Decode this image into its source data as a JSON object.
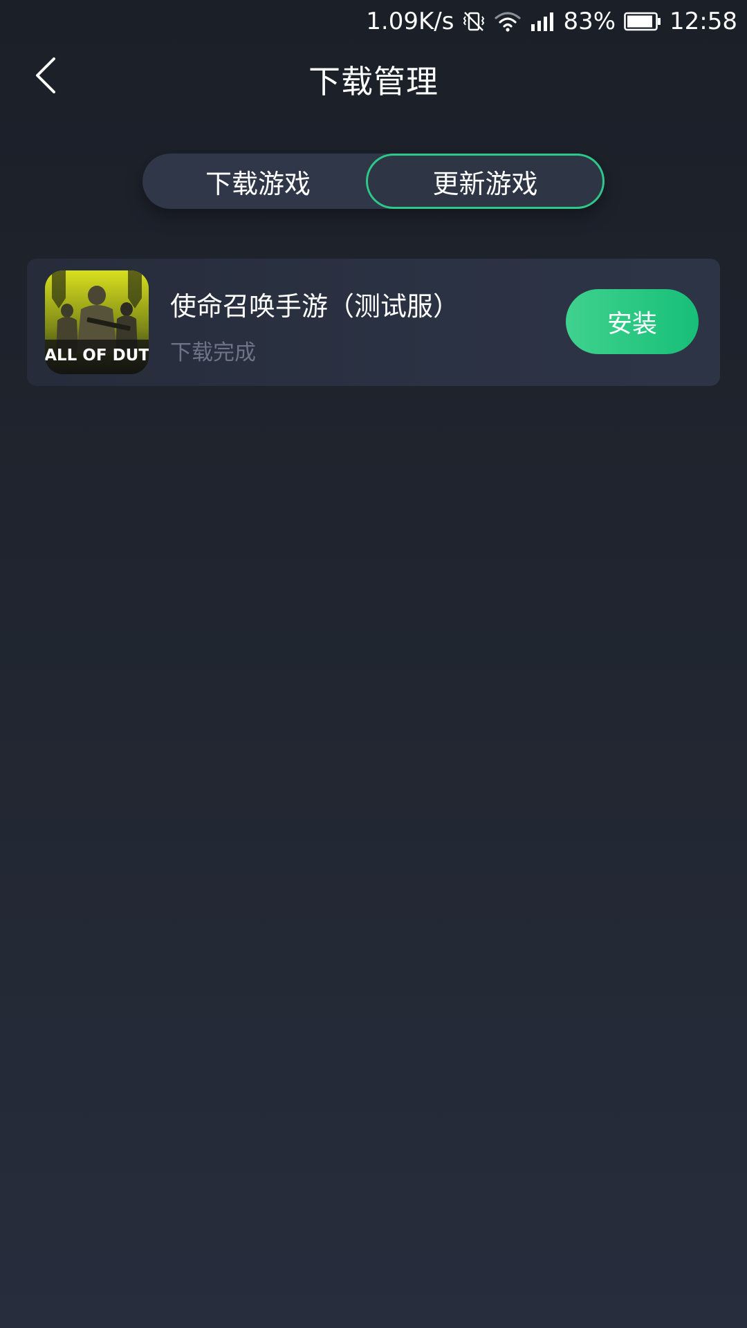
{
  "status_bar": {
    "speed": "1.09K/s",
    "battery": "83%",
    "time": "12:58",
    "icons": [
      "vibrate-off-icon",
      "wifi-icon",
      "signal-icon",
      "battery-icon"
    ]
  },
  "header": {
    "title": "下载管理",
    "back_icon": "chevron-left-icon"
  },
  "tabs": [
    {
      "label": "下载游戏",
      "selected": false
    },
    {
      "label": "更新游戏",
      "selected": true
    }
  ],
  "games": [
    {
      "name": "使命召唤手游（测试服）",
      "status": "下载完成",
      "icon_text": "CALL OF DUTY",
      "action": "安装"
    }
  ],
  "colors": {
    "accent": "#2ec88a",
    "button_start": "#3fd28e",
    "button_end": "#17bf78",
    "background": "#1b1f28",
    "card": "#2b3243",
    "muted_text": "#6e7485"
  }
}
